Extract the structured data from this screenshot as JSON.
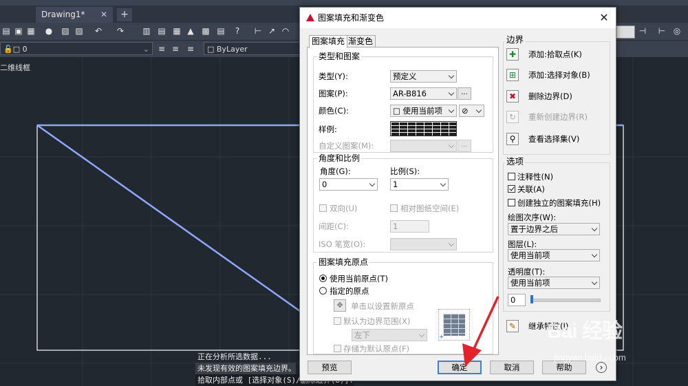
{
  "app": {
    "document_tab": "Drawing1*",
    "tab_close": "✕",
    "new_tab": "+",
    "layer_value": "0",
    "linetype_value": "ByLayer",
    "view_label": "二维线框"
  },
  "command_line": {
    "lines": [
      "正在分析所选数据...",
      "未发现有效的图案填充边界。",
      "拾取内部点或 [选择对象(S)/删除边界(B)]:"
    ]
  },
  "dialog": {
    "title": "图案填充和渐变色",
    "close": "✕",
    "tabs": [
      "图案填充",
      "渐变色"
    ],
    "type_group": {
      "title": "类型和图案",
      "type_label": "类型(Y):",
      "type_value": "预定义",
      "pattern_label": "图案(P):",
      "pattern_value": "AR-B816",
      "pattern_browse": "...",
      "color_label": "颜色(C):",
      "color_value": "使用当前项",
      "sample_label": "样例:",
      "custom_label": "自定义图案(M):",
      "custom_browse": "..."
    },
    "angle_group": {
      "title": "角度和比例",
      "angle_label": "角度(G):",
      "angle_value": "0",
      "scale_label": "比例(S):",
      "scale_value": "1",
      "double_label": "双向(U)",
      "relative_label": "相对图纸空间(E)",
      "spacing_label": "间距(C):",
      "spacing_value": "1",
      "iso_label": "ISO 笔宽(O):"
    },
    "origin_group": {
      "title": "图案填充原点",
      "use_current": "使用当前原点(T)",
      "specified": "指定的原点",
      "click_set": "单击以设置新原点",
      "default_extent": "默认为边界范围(X)",
      "extent_value": "左下",
      "store_default": "存储为默认原点(F)"
    },
    "boundary": {
      "title": "边界",
      "add_pick": "添加:拾取点(K)",
      "add_select": "添加:选择对象(B)",
      "remove": "删除边界(D)",
      "recreate": "重新创建边界(R)",
      "view_selection": "查看选择集(V)"
    },
    "options": {
      "title": "选项",
      "annotative": "注释性(N)",
      "associative": "关联(A)",
      "independent": "创建独立的图案填充(H)",
      "draw_order_label": "绘图次序(W):",
      "draw_order_value": "置于边界之后",
      "layer_label": "图层(L):",
      "layer_value": "使用当前项",
      "transparency_label": "透明度(T):",
      "transparency_type": "使用当前项",
      "transparency_value": "0"
    },
    "inherit": "继承特性(I)",
    "footer": {
      "preview": "预览",
      "ok": "确定",
      "cancel": "取消",
      "help": "帮助",
      "more": "›"
    }
  },
  "watermark": {
    "brand": "Bai 经验",
    "site": "jingyan.baidu.com"
  },
  "colors": {
    "canvas": "#212830",
    "drawing_line": "#8fa8ff",
    "arrow": "#e3232b",
    "default_button_border": "#3c7fd5"
  }
}
